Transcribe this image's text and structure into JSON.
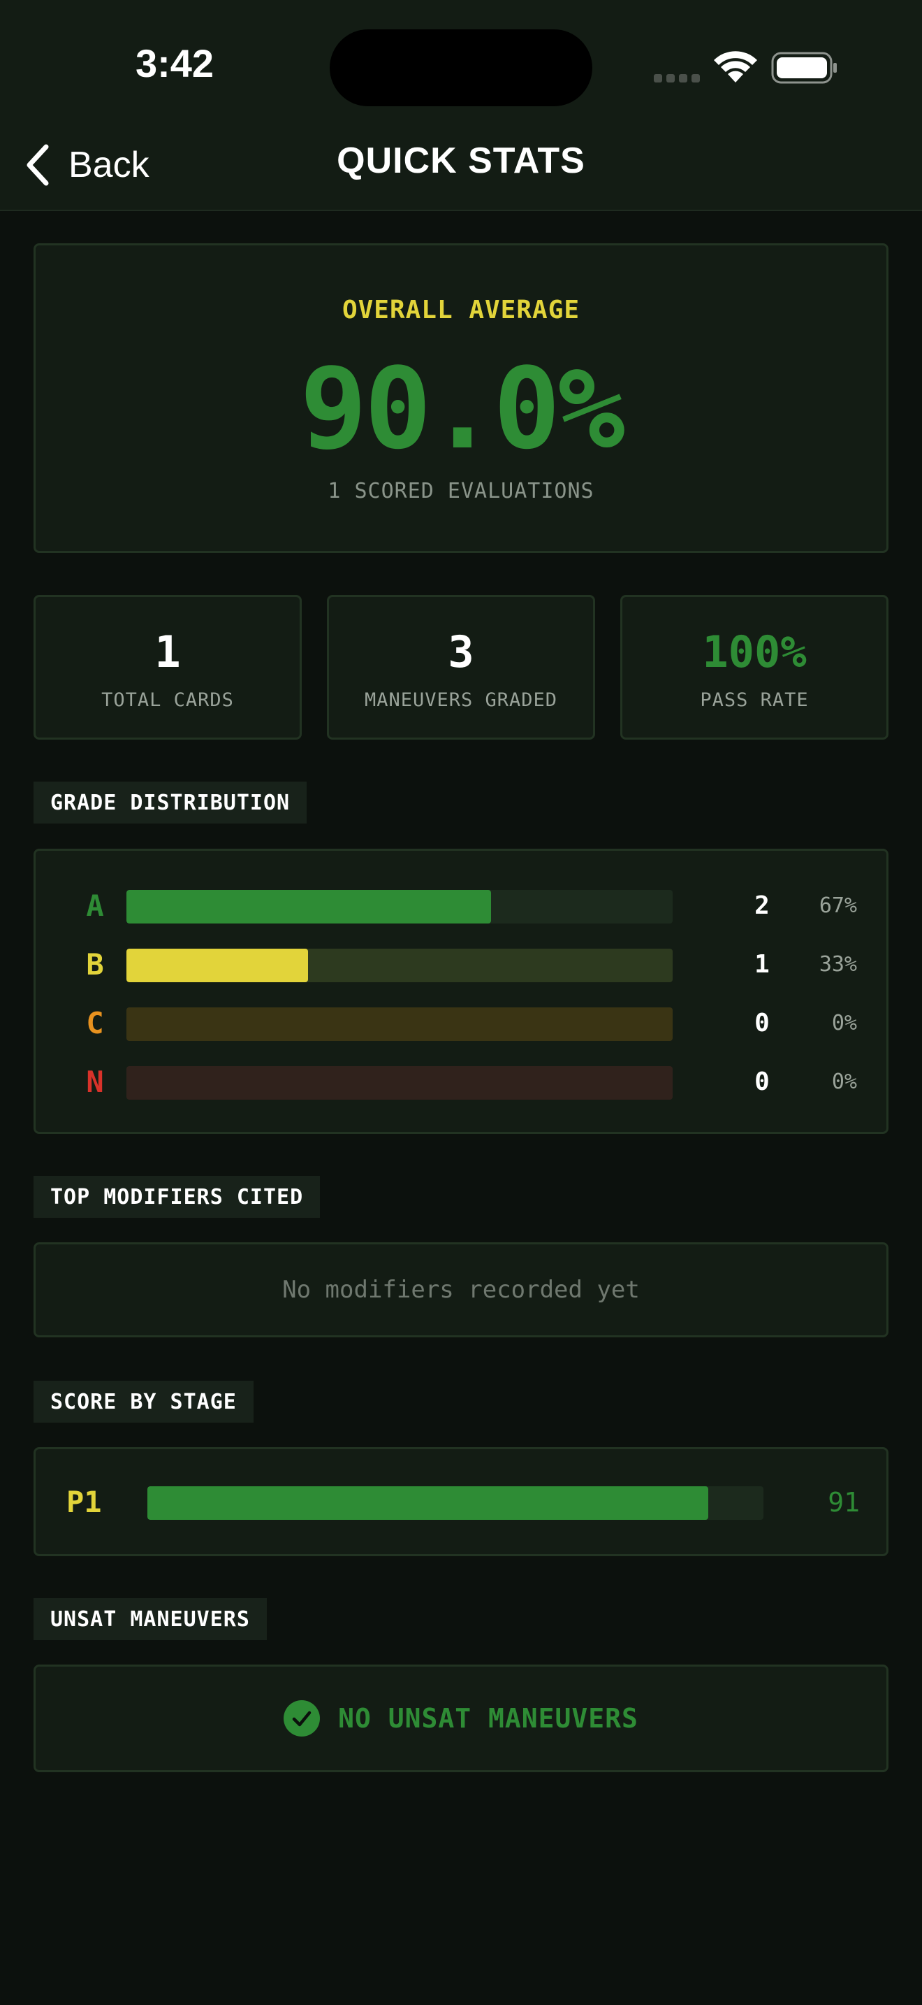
{
  "status_bar": {
    "time": "3:42"
  },
  "nav": {
    "back_label": "Back",
    "title": "QUICK STATS"
  },
  "overall": {
    "label": "OVERALL AVERAGE",
    "value": "90.0%",
    "subtitle": "1 SCORED EVALUATIONS"
  },
  "stats": [
    {
      "value": "1",
      "label": "TOTAL CARDS"
    },
    {
      "value": "3",
      "label": "MANEUVERS GRADED"
    },
    {
      "value": "100%",
      "label": "PASS RATE"
    }
  ],
  "grade_distribution": {
    "title": "GRADE DISTRIBUTION",
    "rows": [
      {
        "grade": "A",
        "count": "2",
        "percent": "67%",
        "fraction": 0.667,
        "color": "#2e8c35",
        "track": "#1c2a1d",
        "letter_color": "#2e8c35"
      },
      {
        "grade": "B",
        "count": "1",
        "percent": "33%",
        "fraction": 0.333,
        "color": "#e2d43a",
        "track": "#2d3a1f",
        "letter_color": "#e2d43a"
      },
      {
        "grade": "C",
        "count": "0",
        "percent": "0%",
        "fraction": 0,
        "color": "#e8921f",
        "track": "#3a3414",
        "letter_color": "#e8921f"
      },
      {
        "grade": "N",
        "count": "0",
        "percent": "0%",
        "fraction": 0,
        "color": "#d8322a",
        "track": "#30221c",
        "letter_color": "#d8322a"
      }
    ]
  },
  "modifiers": {
    "title": "TOP MODIFIERS CITED",
    "empty_text": "No modifiers recorded yet"
  },
  "score_by_stage": {
    "title": "SCORE BY STAGE",
    "stages": [
      {
        "stage": "P1",
        "score": "91",
        "fraction": 0.91
      }
    ]
  },
  "unsat": {
    "title": "UNSAT MANEUVERS",
    "empty_text": "NO UNSAT MANEUVERS"
  },
  "colors": {
    "background": "#0c110d",
    "card": "#131c14",
    "accent_green": "#2e8c35",
    "accent_yellow": "#e2d43a"
  }
}
